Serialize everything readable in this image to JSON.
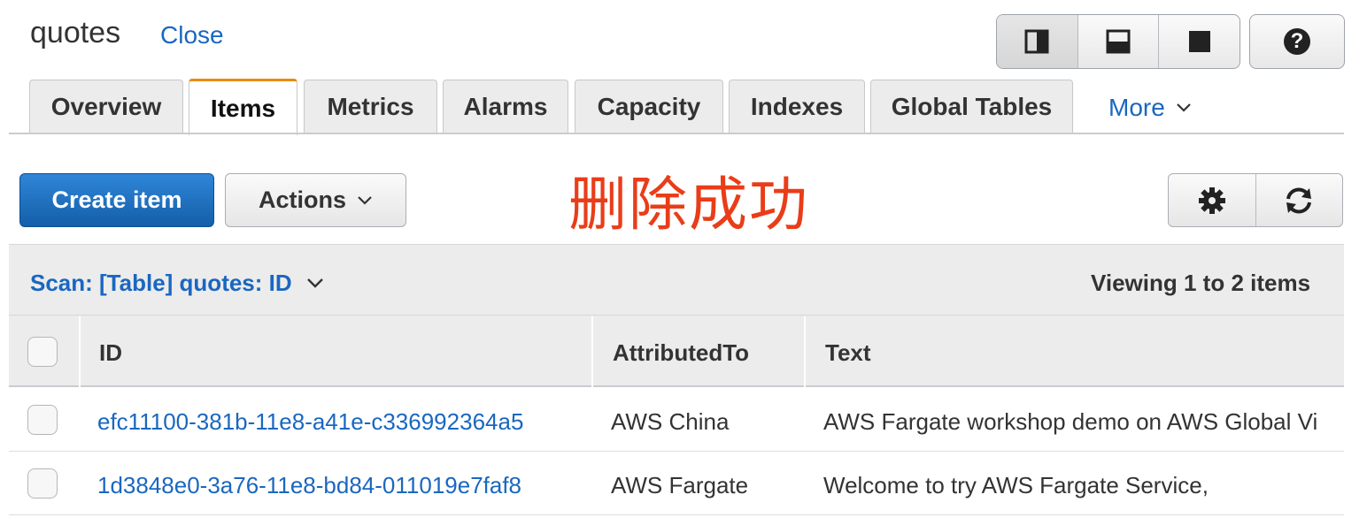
{
  "header": {
    "title": "quotes",
    "close_label": "Close",
    "layout_icons": [
      "split-vertical-icon",
      "split-horizontal-icon",
      "full-view-icon"
    ],
    "help_label": "?"
  },
  "tabs": [
    {
      "label": "Overview",
      "active": false
    },
    {
      "label": "Items",
      "active": true
    },
    {
      "label": "Metrics",
      "active": false
    },
    {
      "label": "Alarms",
      "active": false
    },
    {
      "label": "Capacity",
      "active": false
    },
    {
      "label": "Indexes",
      "active": false
    },
    {
      "label": "Global Tables",
      "active": false
    }
  ],
  "more_label": "More",
  "toolbar": {
    "create_label": "Create item",
    "actions_label": "Actions",
    "success_message": "删除成功",
    "settings_icon": "gear-icon",
    "refresh_icon": "refresh-icon"
  },
  "scan": {
    "label": "Scan: [Table] quotes: ID",
    "viewing": "Viewing 1 to 2 items"
  },
  "table": {
    "columns": [
      "ID",
      "AttributedTo",
      "Text"
    ],
    "rows": [
      {
        "id": "efc11100-381b-11e8-a41e-c336992364a5",
        "attributed_to": "AWS China",
        "text": "AWS Fargate workshop demo on AWS Global Vi"
      },
      {
        "id": "1d3848e0-3a76-11e8-bd84-011019e7faf8",
        "attributed_to": "AWS Fargate",
        "text": "Welcome to try AWS Fargate Service,"
      }
    ]
  },
  "colors": {
    "link": "#1a67c0",
    "primary_button": "#1f6fc5",
    "active_tab_accent": "#e88b12",
    "success_message": "#e93d19"
  }
}
